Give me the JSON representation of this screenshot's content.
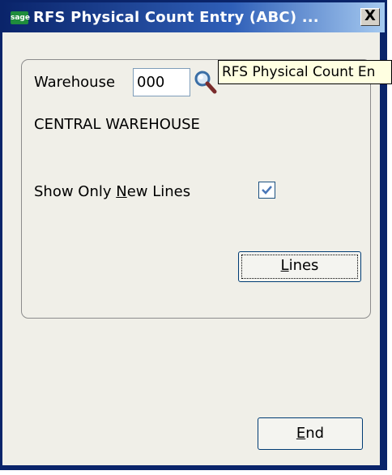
{
  "window": {
    "title": "RFS Physical Count Entry (ABC) ...",
    "icon_text": "sage",
    "close_label": "X"
  },
  "tooltip": {
    "text": "RFS Physical Count En"
  },
  "form": {
    "warehouse_label": "Warehouse",
    "warehouse_value": "000",
    "warehouse_name": "CENTRAL WAREHOUSE",
    "show_new_lines": {
      "before": "Show Only ",
      "mnemonic": "N",
      "after": "ew Lines",
      "checked": true
    }
  },
  "buttons": {
    "lines": {
      "mnemonic": "L",
      "rest": "ines"
    },
    "end": {
      "mnemonic": "E",
      "rest": "nd"
    }
  },
  "icons": {
    "lookup": "magnifier-icon",
    "check": "checkmark-icon"
  }
}
